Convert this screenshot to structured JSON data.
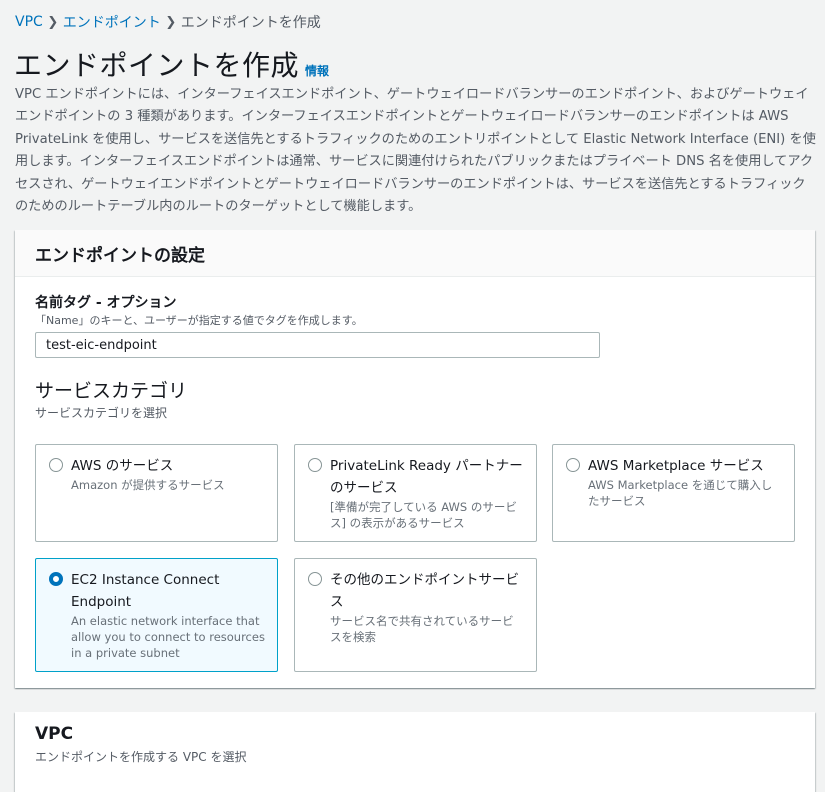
{
  "breadcrumb": {
    "items": [
      "VPC",
      "エンドポイント"
    ],
    "current": "エンドポイントを作成"
  },
  "page": {
    "title": "エンドポイントを作成",
    "info_link": "情報",
    "intro": "VPC エンドポイントには、インターフェイスエンドポイント、ゲートウェイロードバランサーのエンドポイント、およびゲートウェイエンドポイントの 3 種類があります。インターフェイスエンドポイントとゲートウェイロードバランサーのエンドポイントは AWS PrivateLink を使用し、サービスを送信先とするトラフィックのためのエントリポイントとして Elastic Network Interface (ENI) を使用します。インターフェイスエンドポイントは通常、サービスに関連付けられたパブリックまたはプライベート DNS 名を使用してアクセスされ、ゲートウェイエンドポイントとゲートウェイロードバランサーのエンドポイントは、サービスを送信先とするトラフィックのためのルートテーブル内のルートのターゲットとして機能します。"
  },
  "endpoint_settings": {
    "title": "エンドポイントの設定",
    "name_tag": {
      "label": "名前タグ - オプション",
      "description": "「Name」のキーと、ユーザーが指定する値でタグを作成します。",
      "value": "test-eic-endpoint"
    },
    "service_category": {
      "heading": "サービスカテゴリ",
      "description": "サービスカテゴリを選択",
      "options": [
        {
          "title": "AWS のサービス",
          "description": "Amazon が提供するサービス",
          "selected": false
        },
        {
          "title": "PrivateLink Ready パートナーのサービス",
          "description": "[準備が完了している AWS のサービス] の表示があるサービス",
          "selected": false
        },
        {
          "title": "AWS Marketplace サービス",
          "description": "AWS Marketplace を通じて購入したサービス",
          "selected": false
        },
        {
          "title": "EC2 Instance Connect Endpoint",
          "description": "An elastic network interface that allow you to connect to resources in a private subnet",
          "selected": true
        },
        {
          "title": "その他のエンドポイントサービス",
          "description": "サービス名で共有されているサービスを検索",
          "selected": false
        }
      ]
    }
  },
  "vpc_section": {
    "title": "VPC",
    "description": "エンドポイントを作成する VPC を選択"
  },
  "colors": {
    "accent": "#0073bb",
    "selected_border": "#00a1c9",
    "selected_bg": "#f1faff",
    "page_bg": "#f2f3f3"
  }
}
